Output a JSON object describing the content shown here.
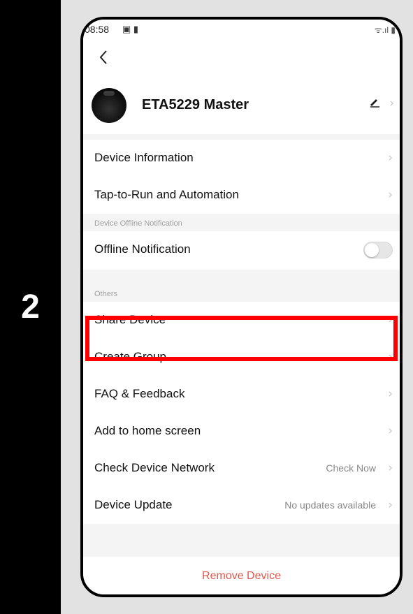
{
  "step": {
    "number": "2"
  },
  "status_bar": {
    "time": "08:58",
    "icons": "▣ ▮",
    "signal": "ᯤ.ıl ▮"
  },
  "device": {
    "name": "ETA5229 Master"
  },
  "menu": {
    "device_information": "Device Information",
    "tap_to_run": "Tap-to-Run and Automation",
    "offline_section_label": "Device Offline Notification",
    "offline_notification": "Offline Notification",
    "offline_toggle_on": false,
    "others_section_label": "Others",
    "share_device": "Share Device",
    "create_group": "Create Group",
    "faq_feedback": "FAQ & Feedback",
    "add_home_screen": "Add to home screen",
    "check_network": "Check Device Network",
    "check_network_value": "Check Now",
    "device_update": "Device Update",
    "device_update_value": "No updates available",
    "remove_device": "Remove Device"
  },
  "colors": {
    "highlight": "#ff0000",
    "remove": "#e2584d"
  }
}
